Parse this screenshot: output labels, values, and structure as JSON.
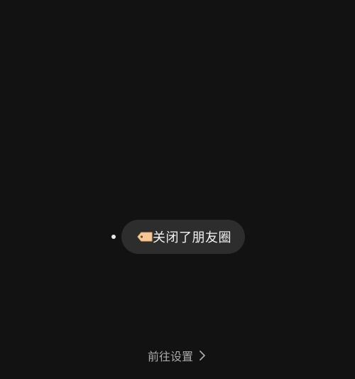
{
  "status": {
    "icon": "tag-icon",
    "text": "关闭了朋友圈"
  },
  "footer": {
    "link_label": "前往设置",
    "link_icon": "chevron-right-icon"
  },
  "colors": {
    "background": "#121212",
    "pill": "#2d2d2d",
    "tag": "#f6c896",
    "text": "#f2f2f2",
    "link": "#a9a9a9"
  }
}
